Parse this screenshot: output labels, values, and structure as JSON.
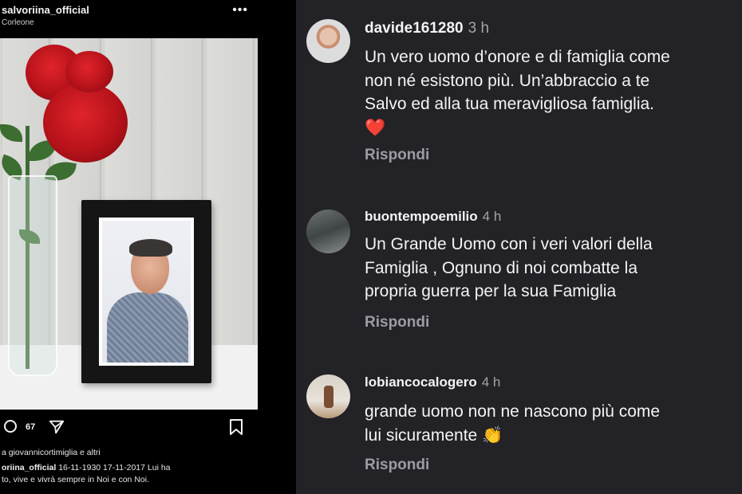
{
  "post": {
    "username": "salvoriina_official",
    "location": "Corleone",
    "comment_count": "67",
    "likes_text": "a giovannicortimiglia e altri",
    "caption_user": "oriina_official",
    "caption_text": "16-11-1930 17-11-2017  Lui ha",
    "caption_line2": "to, vive e vivrà sempre in Noi e con Noi."
  },
  "comments": [
    {
      "username": "davide161280",
      "time": "3 h",
      "lines": [
        "Un vero uomo d’onore e di famiglia come",
        "non né esistono più. Un’abbraccio a te",
        "Salvo ed alla tua meravigliosa famiglia.",
        "❤️"
      ],
      "reply": "Rispondi"
    },
    {
      "username": "buontempoemilio",
      "time": "4 h",
      "lines": [
        "Un Grande Uomo con i veri valori della",
        "Famiglia , Ognuno di noi combatte la",
        "propria guerra per la sua Famiglia"
      ],
      "reply": "Rispondi"
    },
    {
      "username": "lobiancocalogero",
      "time": "4 h",
      "lines": [
        "grande uomo non ne nascono più come",
        "lui sicuramente 👏"
      ],
      "reply": "Rispondi"
    }
  ],
  "colors": {
    "comments_bg": "#222227",
    "heart": "#e0242a",
    "reply_text": "#9c9ca3"
  }
}
